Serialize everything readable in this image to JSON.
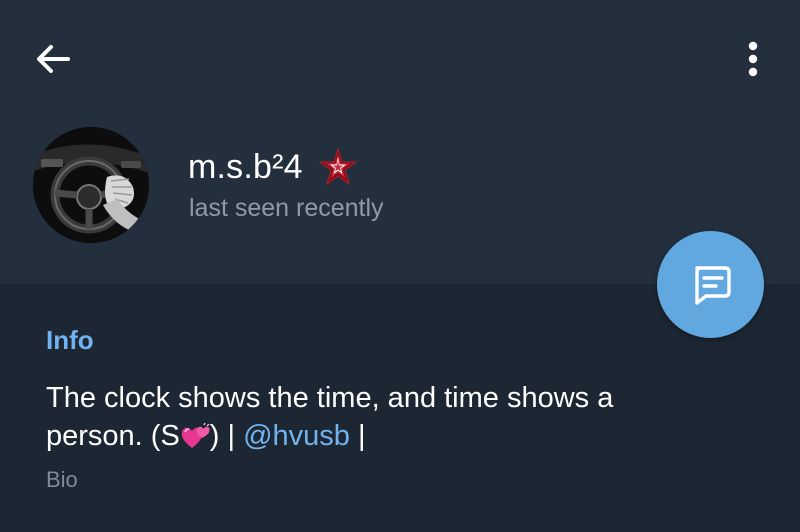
{
  "header": {
    "back_icon": "arrow-left-icon",
    "menu_icon": "more-vertical-icon"
  },
  "profile": {
    "avatar_icon": "avatar-steering-wheel",
    "name": "m.s.b²4",
    "badge_icon": "red-star-icon",
    "status": "last seen recently"
  },
  "fab": {
    "icon": "message-icon",
    "color": "#62a8e0"
  },
  "info": {
    "title": "Info",
    "bio_line1": "The clock shows the time, and time shows a",
    "bio_line2_prefix": "person. (S",
    "bio_line2_emoji_icon": "two-hearts-emoji",
    "bio_line2_sep1": ") | ",
    "bio_link": "@hvusb",
    "bio_line2_sep2": " |",
    "bio_label": "Bio"
  },
  "colors": {
    "header_bg": "#232f3d",
    "body_bg": "#1d2733",
    "accent": "#71b3ee",
    "secondary_text": "#8f9aa6"
  }
}
